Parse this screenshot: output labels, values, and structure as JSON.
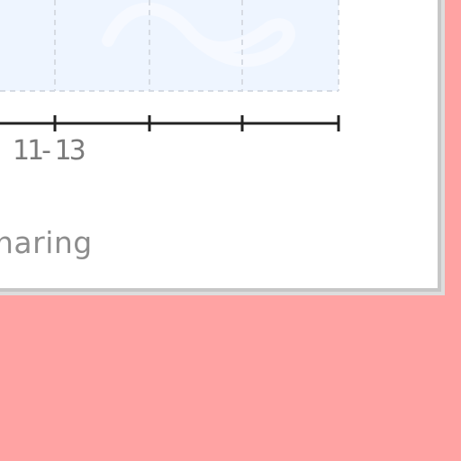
{
  "window": {
    "background_color": "#ffa3a3",
    "panel_color": "#ffffff",
    "panel_border_color": "#c7c7c7"
  },
  "chart": {
    "x_tick_label": "11- 13",
    "caption": "haring",
    "area_fill_color": "#eef5ff",
    "grid_color": "#d6dbe3",
    "axis_color": "#222222"
  }
}
